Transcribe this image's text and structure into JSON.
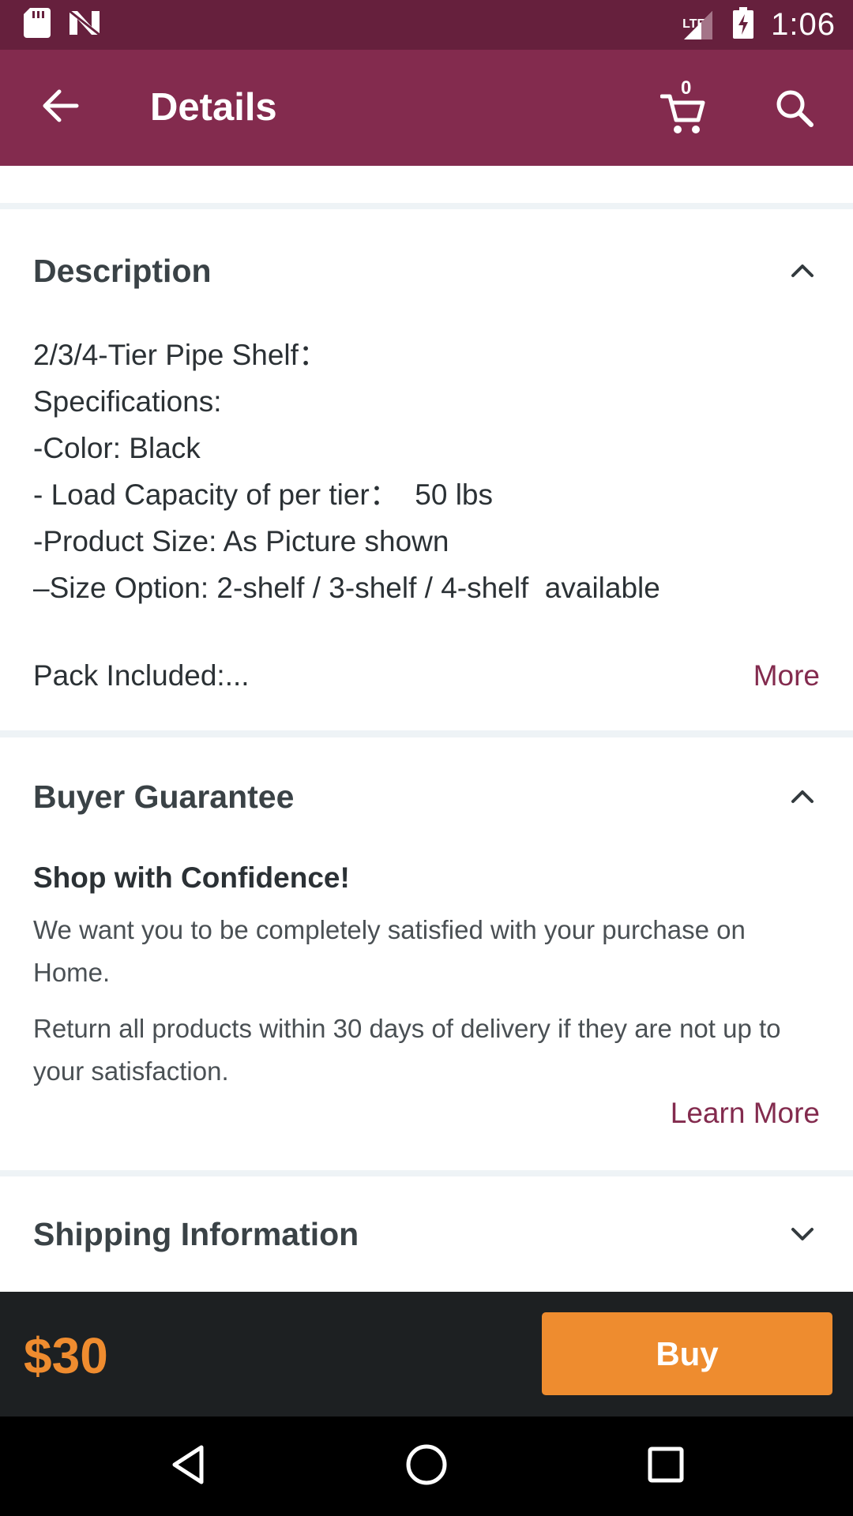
{
  "status_bar": {
    "time": "1:06",
    "network": "LTE",
    "icons": [
      "sd-card-icon",
      "n-icon",
      "lte-signal-icon",
      "battery-charging-icon"
    ]
  },
  "app_bar": {
    "title": "Details",
    "cart_count": "0"
  },
  "description": {
    "title": "Description",
    "lines": "2/3/4-Tier Pipe Shelf：\nSpecifications:\n-Color: Black\n- Load Capacity of per tier：  50 lbs\n-Product Size: As Picture shown\n–Size Option: 2-shelf / 3-shelf / 4-shelf  available",
    "pack_included": "Pack Included:...",
    "more_label": "More"
  },
  "buyer_guarantee": {
    "title": "Buyer Guarantee",
    "heading": "Shop with Confidence!",
    "paragraph_1": "We want you to be completely satisfied with your purchase on Home.",
    "paragraph_2": "Return all products within 30 days of delivery if they are not up to your satisfaction.",
    "learn_more_label": "Learn More"
  },
  "shipping": {
    "title": "Shipping Information"
  },
  "buy_bar": {
    "price": "$30",
    "buy_label": "Buy"
  },
  "colors": {
    "status_bar": "#66203d",
    "app_bar": "#832b4e",
    "accent_link": "#832b4e",
    "price": "#ef8c2f",
    "buy_button": "#ee8c2f"
  }
}
